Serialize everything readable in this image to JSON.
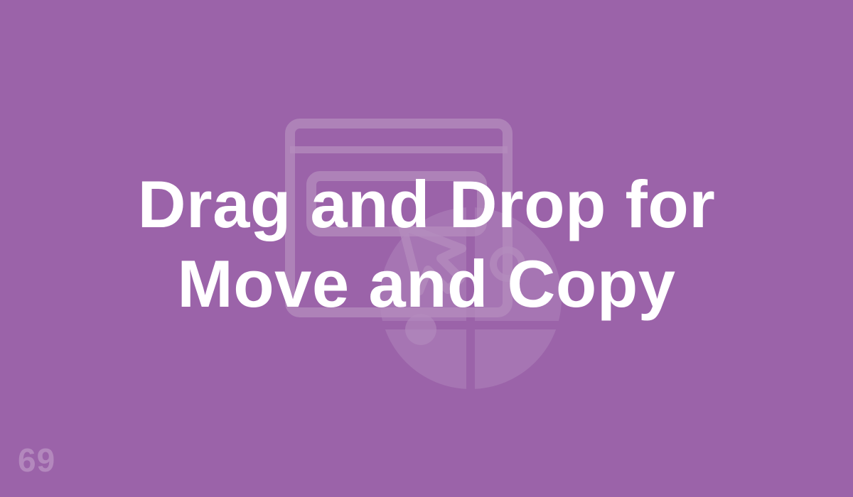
{
  "colors": {
    "background": "#9b63a9",
    "illustration": "#b48cbe",
    "title_text": "#ffffff",
    "badge_text": "#c7a7cf"
  },
  "icon": "window-drag-cursor-icon",
  "title": {
    "line1": "Drag and Drop for",
    "line2": "Move and Copy"
  },
  "badge": "69"
}
